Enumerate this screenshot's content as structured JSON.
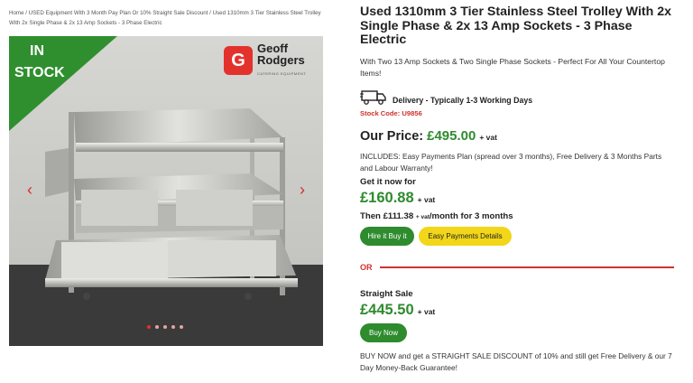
{
  "breadcrumb": "Home / USED Equipment With 3 Month Pay Plan Or 10% Straight Sale Discount / Used 1310mm 3 Tier Stainless Steel Trolley With 2x Single Phase & 2x 13 Amp Sockets - 3 Phase Electric",
  "gallery": {
    "badge_line1": "IN",
    "badge_line2": "STOCK",
    "brand_line1": "Geoff",
    "brand_line2": "Rodgers",
    "brand_tagline": "CATERING EQUIPMENT",
    "prev_icon": "‹",
    "next_icon": "›",
    "dot_count": 5,
    "active_dot": 0
  },
  "product": {
    "title": "Used 1310mm 3 Tier Stainless Steel Trolley With 2x Single Phase & 2x 13 Amp Sockets - 3 Phase Electric",
    "description": "With Two 13 Amp Sockets & Two Single Phase Sockets - Perfect For All Your Countertop Items!",
    "delivery": "Delivery - Typically 1-3 Working Days",
    "stock_code": "Stock Code: U9856"
  },
  "pricing": {
    "our_price_label": "Our Price:",
    "our_price": "£495.00",
    "vat_label": "+ vat",
    "includes": "INCLUDES: Easy Payments Plan (spread over 3 months), Free Delivery & 3 Months Parts and Labour Warranty!",
    "get_it_now": "Get it now for",
    "finance_price": "£160.88",
    "then_text": "Then £111.38",
    "then_small": "+ vat",
    "then_suffix": "/month for 3 months",
    "hire_button": "Hire it Buy it",
    "easy_button": "Easy Payments Details",
    "or_label": "OR",
    "straight_title": "Straight Sale",
    "straight_price": "£445.50",
    "buy_button": "Buy Now",
    "buy_note": "BUY NOW and get a STRAIGHT SALE DISCOUNT of 10% and still get Free Delivery & our 7 Day Money-Back Guarantee!"
  },
  "colors": {
    "accent_red": "#d0312d",
    "price_green": "#2e8b2e",
    "button_yellow": "#f2d619",
    "stock_green": "#2f8f2f"
  },
  "icons": {
    "delivery": "delivery-truck-icon"
  }
}
